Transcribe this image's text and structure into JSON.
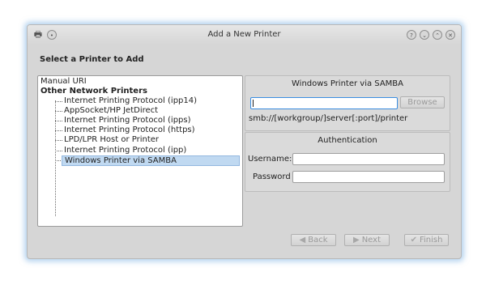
{
  "window": {
    "title": "Add a New Printer",
    "left_icons": [
      "printer-icon",
      "menu-icon"
    ],
    "controls": [
      {
        "name": "help-icon",
        "glyph": "?"
      },
      {
        "name": "minimize-icon",
        "glyph": "⌄"
      },
      {
        "name": "maximize-icon",
        "glyph": "⌃"
      },
      {
        "name": "close-icon",
        "glyph": "✕"
      }
    ]
  },
  "heading": "Select a Printer to Add",
  "tree": {
    "top_item": "Manual URI",
    "group": "Other Network Printers",
    "children": [
      "Internet Printing Protocol (ipp14)",
      "AppSocket/HP JetDirect",
      "Internet Printing Protocol (ipps)",
      "Internet Printing Protocol (https)",
      "LPD/LPR Host or Printer",
      "Internet Printing Protocol (ipp)",
      "Windows Printer via SAMBA"
    ],
    "selected_index": 6
  },
  "samba_panel": {
    "title": "Windows Printer via SAMBA",
    "uri_value": "",
    "browse_label": "Browse",
    "hint": "smb://[workgroup/]server[:port]/printer"
  },
  "auth_panel": {
    "title": "Authentication",
    "username_label": "Username:",
    "username_value": "",
    "password_label": "Password",
    "password_value": ""
  },
  "nav": {
    "back_label": "Back",
    "next_label": "Next",
    "finish_label": "Finish"
  },
  "colors": {
    "selection": "#c0d9f1",
    "focus_border": "#3a8de0",
    "window_glow": "#78afe1"
  }
}
